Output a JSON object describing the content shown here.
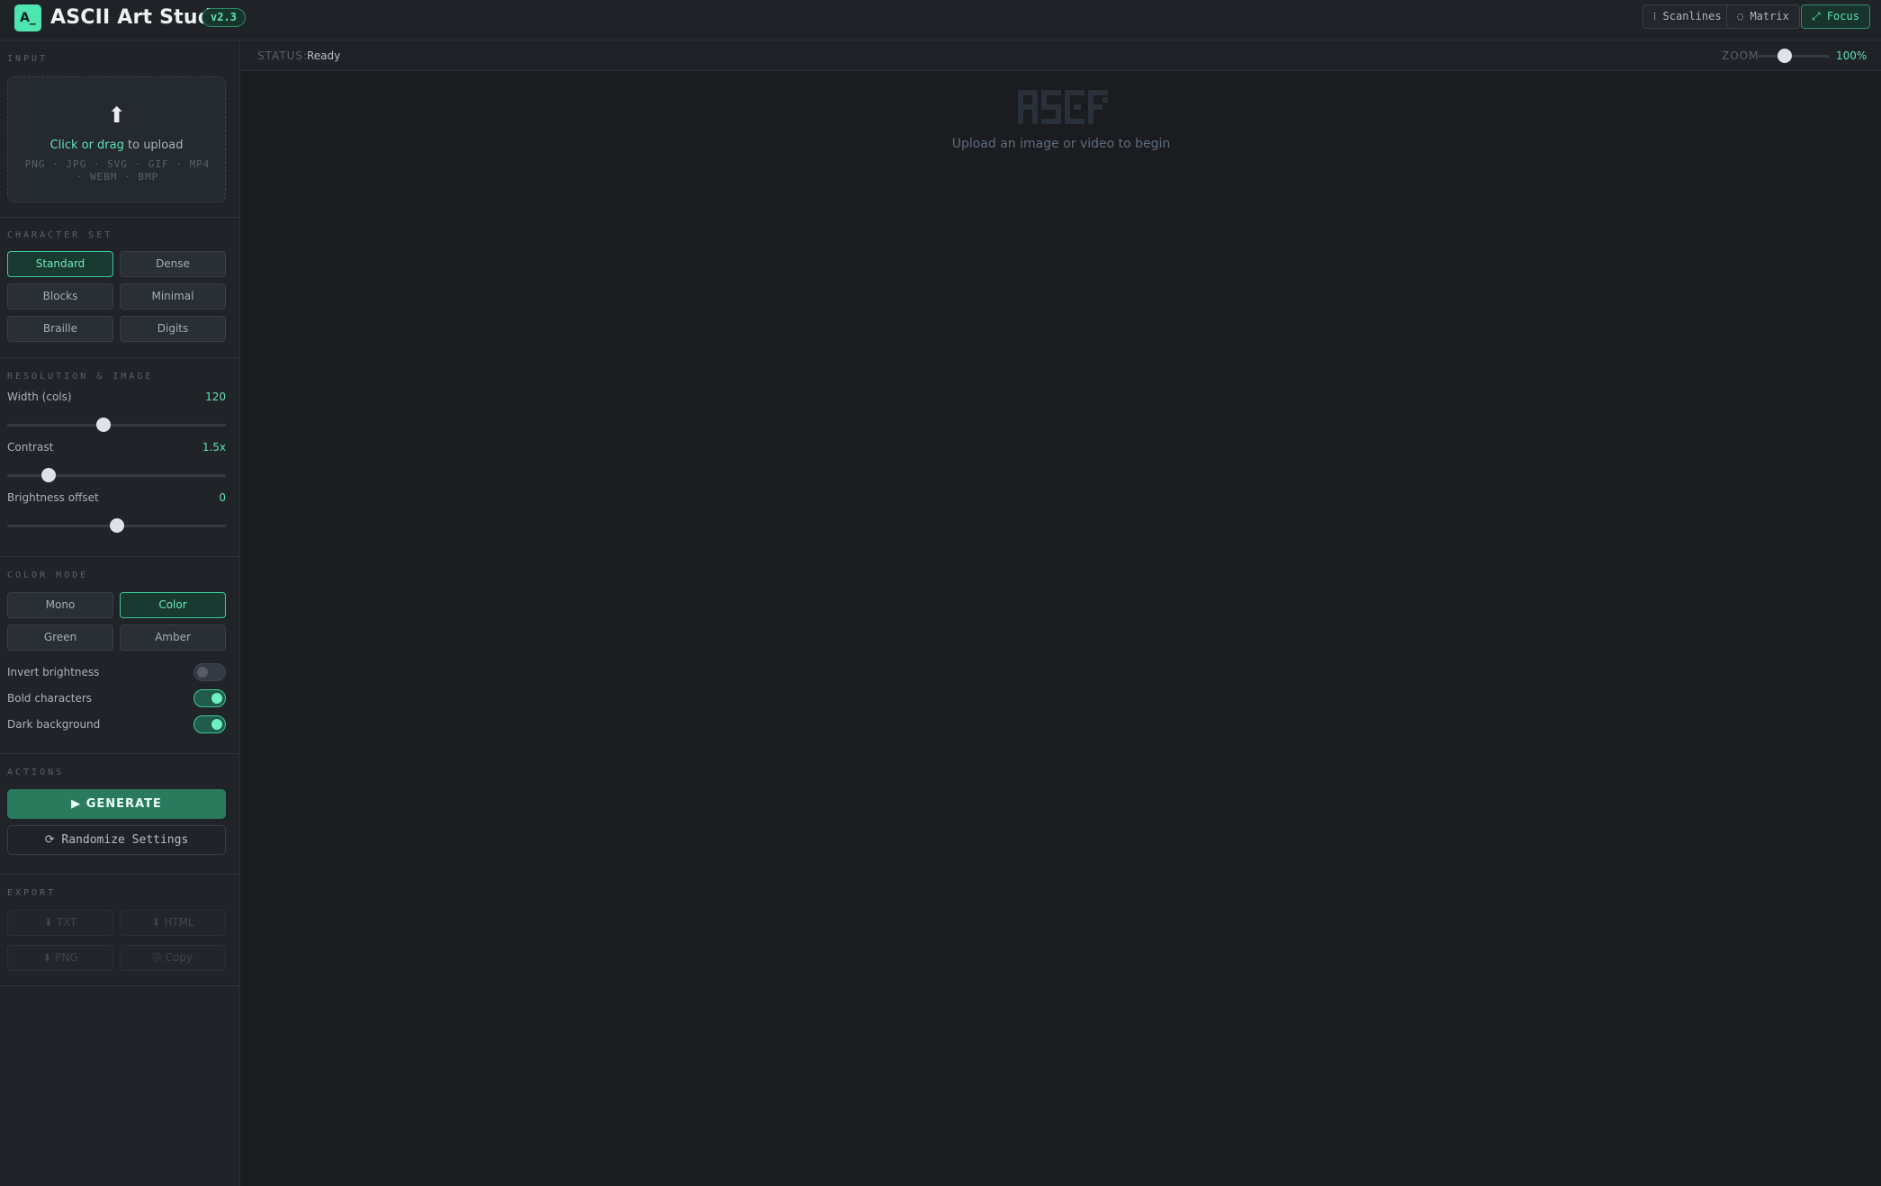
{
  "header": {
    "logo": "A_",
    "title": "ASCII Art Studio",
    "version": "v2.3",
    "buttons": {
      "scanlines": "⁞ Scanlines",
      "matrix": "◌ Matrix",
      "focus": "⤢ Focus"
    }
  },
  "status": {
    "label": "STATUS:",
    "value": "Ready",
    "zoom_label": "ZOOM",
    "zoom_value": "100%",
    "zoom_percent": 100
  },
  "sidebar": {
    "input": {
      "title": "INPUT",
      "upload_icon": "⬆",
      "upload_action": "Click or drag",
      "upload_suffix": " to upload",
      "formats": "PNG · JPG · SVG · GIF · MP4 · WEBM · BMP"
    },
    "charset": {
      "title": "CHARACTER SET",
      "options": [
        "Standard",
        "Dense",
        "Blocks",
        "Minimal",
        "Braille",
        "Digits"
      ],
      "selected": "Standard"
    },
    "resolution": {
      "title": "RESOLUTION & IMAGE",
      "width_label": "Width (cols)",
      "width_value": "120",
      "width_fraction": 0.44,
      "contrast_label": "Contrast",
      "contrast_value": "1.5x",
      "contrast_fraction": 0.19,
      "brightness_label": "Brightness offset",
      "brightness_value": "0",
      "brightness_fraction": 0.5
    },
    "color": {
      "title": "COLOR MODE",
      "options": [
        "Mono",
        "Color",
        "Green",
        "Amber"
      ],
      "selected": "Color",
      "invert_label": "Invert brightness",
      "invert_on": false,
      "bold_label": "Bold characters",
      "bold_on": true,
      "dark_label": "Dark background",
      "dark_on": true
    },
    "actions": {
      "title": "ACTIONS",
      "generate": "▶ GENERATE",
      "randomize": "⟳ Randomize Settings"
    },
    "export": {
      "title": "EXPORT",
      "txt": "⬇ TXT",
      "html": "⬇ HTML",
      "png": "⬇ PNG",
      "copy": "⎘ Copy"
    }
  },
  "canvas": {
    "empty_text": "Upload an image or video to begin"
  },
  "colors": {
    "accent": "#5fe3b5",
    "background": "#1a1c20",
    "panel": "#202328"
  }
}
